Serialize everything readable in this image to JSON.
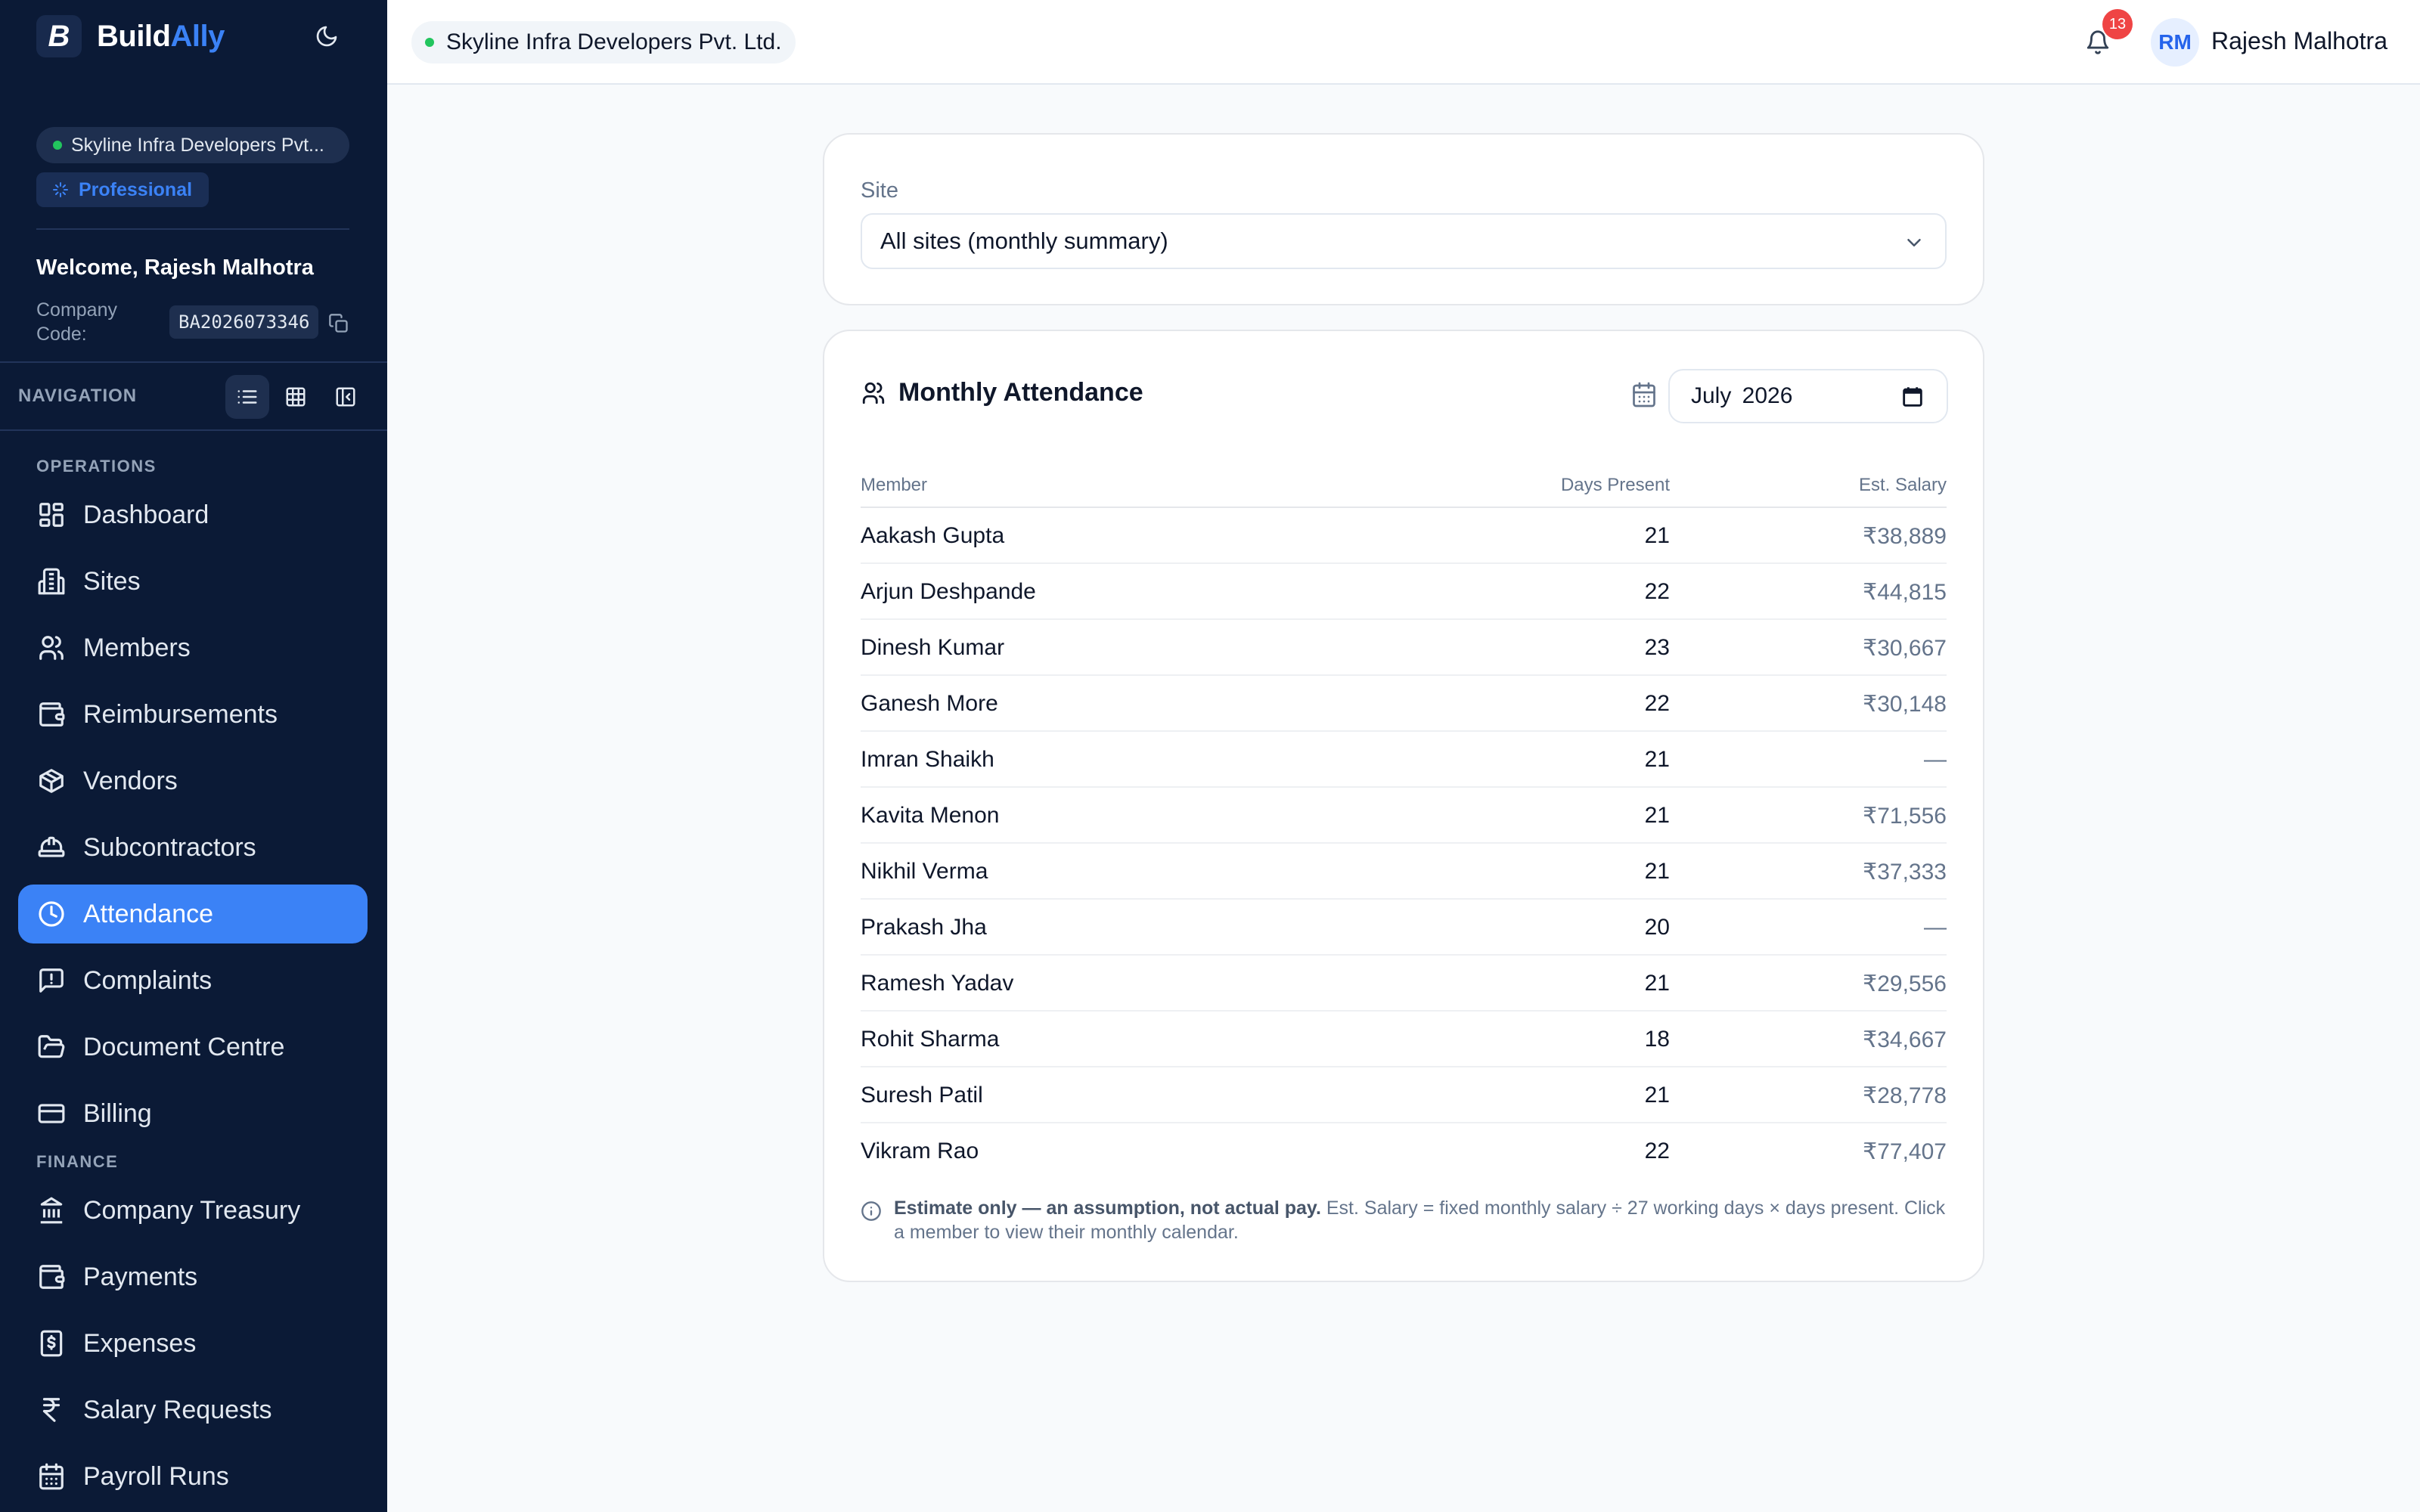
{
  "sidebar": {
    "brand": {
      "name_part1": "Build",
      "name_part2": "Ally",
      "logo_letter": "B"
    },
    "company_name": "Skyline Infra Developers Pvt...",
    "plan": "Professional",
    "welcome": "Welcome, Rajesh Malhotra",
    "company_code_label": "Company Code:",
    "company_code": "BA2026073346",
    "navigation_label": "NAVIGATION",
    "sections": [
      {
        "label": "OPERATIONS"
      },
      {
        "label": "FINANCE"
      }
    ],
    "items": [
      {
        "label": "Dashboard",
        "icon": "dashboard-icon"
      },
      {
        "label": "Sites",
        "icon": "building-icon"
      },
      {
        "label": "Members",
        "icon": "users-icon"
      },
      {
        "label": "Reimbursements",
        "icon": "wallet-icon"
      },
      {
        "label": "Vendors",
        "icon": "package-icon"
      },
      {
        "label": "Subcontractors",
        "icon": "hard-hat-icon"
      },
      {
        "label": "Attendance",
        "icon": "clock-icon",
        "active": true
      },
      {
        "label": "Complaints",
        "icon": "message-alert-icon"
      },
      {
        "label": "Document Centre",
        "icon": "folder-open-icon"
      },
      {
        "label": "Billing",
        "icon": "credit-card-icon"
      },
      {
        "label": "Company Treasury",
        "icon": "bank-icon"
      },
      {
        "label": "Payments",
        "icon": "wallet-icon"
      },
      {
        "label": "Expenses",
        "icon": "receipt-icon"
      },
      {
        "label": "Salary Requests",
        "icon": "rupee-icon"
      },
      {
        "label": "Payroll Runs",
        "icon": "calendar-icon"
      }
    ]
  },
  "header": {
    "company_name": "Skyline Infra Developers Pvt. Ltd.",
    "notification_count": "13",
    "user_initials": "RM",
    "user_name": "Rajesh Malhotra"
  },
  "site_filter": {
    "label": "Site",
    "selected": "All sites (monthly summary)"
  },
  "attendance": {
    "title": "Monthly Attendance",
    "month": "July 2026",
    "columns": {
      "member": "Member",
      "days": "Days Present",
      "salary": "Est. Salary"
    },
    "rows": [
      {
        "name": "Aakash Gupta",
        "days": "21",
        "salary": "₹38,889"
      },
      {
        "name": "Arjun Deshpande",
        "days": "22",
        "salary": "₹44,815"
      },
      {
        "name": "Dinesh Kumar",
        "days": "23",
        "salary": "₹30,667"
      },
      {
        "name": "Ganesh More",
        "days": "22",
        "salary": "₹30,148"
      },
      {
        "name": "Imran Shaikh",
        "days": "21",
        "salary": "—"
      },
      {
        "name": "Kavita Menon",
        "days": "21",
        "salary": "₹71,556"
      },
      {
        "name": "Nikhil Verma",
        "days": "21",
        "salary": "₹37,333"
      },
      {
        "name": "Prakash Jha",
        "days": "20",
        "salary": "—"
      },
      {
        "name": "Ramesh Yadav",
        "days": "21",
        "salary": "₹29,556"
      },
      {
        "name": "Rohit Sharma",
        "days": "18",
        "salary": "₹34,667"
      },
      {
        "name": "Suresh Patil",
        "days": "21",
        "salary": "₹28,778"
      },
      {
        "name": "Vikram Rao",
        "days": "22",
        "salary": "₹77,407"
      }
    ],
    "note_bold": "Estimate only — an assumption, not actual pay.",
    "note_text": " Est. Salary = fixed monthly salary ÷ 27 working days × days present. Click a member to view their monthly calendar."
  },
  "colors": {
    "sidebar_bg": "#0b1a36",
    "accent": "#3b82f6",
    "status_dot": "#22c55e",
    "badge": "#ef4444"
  }
}
